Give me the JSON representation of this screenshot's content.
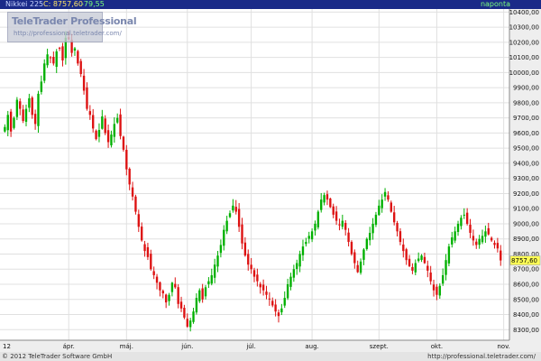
{
  "header": {
    "instrument": "Nikkei 225",
    "close": "C: 8757,60",
    "change": "-79,55",
    "period": "naponta"
  },
  "watermark": {
    "title": "TeleTrader Professional",
    "url": "http://professional.teletrader.com/"
  },
  "footer": {
    "copyright": "© 2012 TeleTrader Software GmbH",
    "url": "http://professional.teletrader.com/"
  },
  "colors": {
    "up": "#00b000",
    "down": "#dd1111",
    "grid": "#e0e0e0",
    "axis_bg": "#eeeeee",
    "last_price_bg": "#ffff55",
    "header_bg": "#1a2a88"
  },
  "chart_data": {
    "type": "candlestick",
    "title": "Nikkei 225",
    "ylim": [
      8230,
      10420
    ],
    "grid": true,
    "y_ticks": [
      8300,
      8400,
      8500,
      8600,
      8700,
      8800,
      8900,
      9000,
      9100,
      9200,
      9300,
      9400,
      9500,
      9600,
      9700,
      9800,
      9900,
      10000,
      10100,
      10200,
      10300,
      10400
    ],
    "y_tick_labels": [
      "8300,00",
      "8400,00",
      "8500,00",
      "8600,00",
      "8700,00",
      "8800,00",
      "8900,00",
      "9000,00",
      "9100,00",
      "9200,00",
      "9300,00",
      "9400,00",
      "9500,00",
      "9600,00",
      "9700,00",
      "9800,00",
      "9900,00",
      "10000,00",
      "10100,00",
      "10200,00",
      "10300,00",
      "10400,00"
    ],
    "x_labels": [
      {
        "day": 0,
        "label": "12"
      },
      {
        "day": 21,
        "label": "ápr."
      },
      {
        "day": 40,
        "label": "máj."
      },
      {
        "day": 60,
        "label": "jún."
      },
      {
        "day": 81,
        "label": "júl."
      },
      {
        "day": 101,
        "label": "aug."
      },
      {
        "day": 123,
        "label": "szept."
      },
      {
        "day": 142,
        "label": "okt."
      },
      {
        "day": 164,
        "label": "nov."
      }
    ],
    "last_price": 8757.6,
    "last_price_label": "8757,60",
    "closes": [
      9640,
      9720,
      9610,
      9700,
      9820,
      9760,
      9680,
      9760,
      9830,
      9720,
      9660,
      9860,
      9940,
      10060,
      10120,
      10100,
      10060,
      10140,
      10160,
      10080,
      10230,
      10220,
      10130,
      10160,
      10060,
      9990,
      9880,
      9760,
      9720,
      9630,
      9560,
      9620,
      9710,
      9600,
      9540,
      9590,
      9660,
      9700,
      9580,
      9490,
      9360,
      9260,
      9180,
      9080,
      8980,
      8890,
      8820,
      8780,
      8700,
      8660,
      8610,
      8560,
      8540,
      8480,
      8530,
      8610,
      8580,
      8470,
      8440,
      8380,
      8320,
      8360,
      8420,
      8510,
      8560,
      8500,
      8580,
      8620,
      8660,
      8730,
      8790,
      8860,
      8960,
      9020,
      9070,
      9120,
      9080,
      8980,
      8870,
      8790,
      8730,
      8700,
      8650,
      8620,
      8580,
      8560,
      8530,
      8500,
      8460,
      8420,
      8390,
      8440,
      8510,
      8600,
      8650,
      8700,
      8740,
      8800,
      8850,
      8880,
      8920,
      8950,
      9000,
      9080,
      9160,
      9190,
      9160,
      9110,
      9060,
      9020,
      8990,
      9020,
      8960,
      8880,
      8800,
      8740,
      8680,
      8750,
      8830,
      8900,
      8940,
      9000,
      9060,
      9120,
      9160,
      9210,
      9160,
      9080,
      9010,
      8950,
      8880,
      8820,
      8760,
      8720,
      8690,
      8740,
      8770,
      8790,
      8740,
      8690,
      8620,
      8560,
      8530,
      8590,
      8660,
      8760,
      8850,
      8910,
      8950,
      9000,
      9040,
      9060,
      9000,
      8940,
      8890,
      8860,
      8900,
      8920,
      8950,
      8930,
      8890,
      8860,
      8837,
      8757.6
    ],
    "seed": 1357
  }
}
